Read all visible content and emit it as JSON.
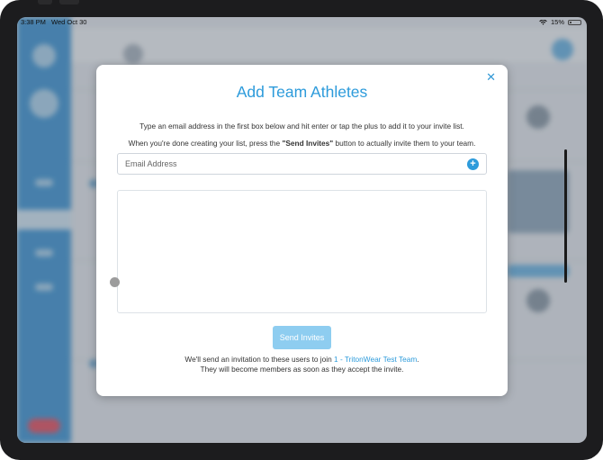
{
  "status_bar": {
    "time": "3:38 PM",
    "date": "Wed Oct 30",
    "battery": "15%"
  },
  "modal": {
    "title": "Add Team Athletes",
    "close_icon": "close-icon",
    "instruction_1": "Type an email address in the first box below and hit enter or tap the plus to add it to your invite list.",
    "instruction_2_prefix": "When you're done creating your list, press the ",
    "instruction_2_bold": "\"Send Invites\"",
    "instruction_2_suffix": " button to actually invite them to your team.",
    "email_placeholder": "Email Address",
    "email_value": "",
    "add_icon": "plus-circle-icon",
    "send_button_label": "Send Invites",
    "footer_prefix": "We'll send an invitation to these users to join ",
    "team_name": "1 - TritonWear Test Team",
    "footer_suffix": ".",
    "footer_line_2": "They will become members as soon as they accept the invite."
  },
  "colors": {
    "accent": "#2d9bdb",
    "send_button_disabled": "#8ecdf0",
    "sidebar": "#5aa6de"
  }
}
